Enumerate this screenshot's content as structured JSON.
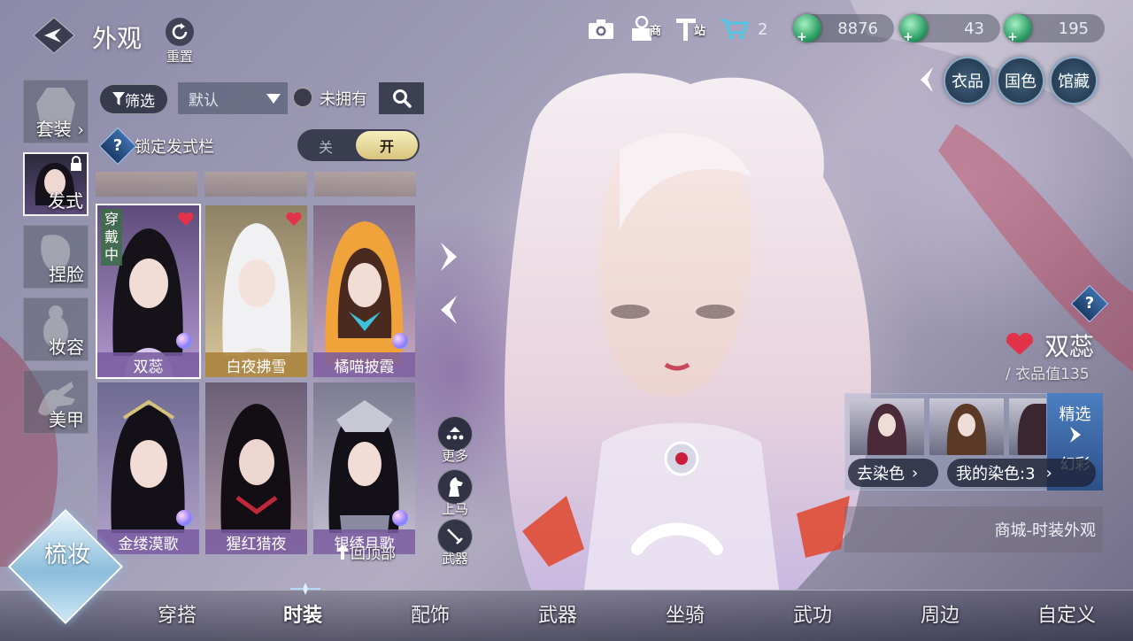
{
  "header": {
    "title": "外观",
    "reset_label": "重置"
  },
  "top_icons": {
    "shop_glyph": "商",
    "station_glyph": "站",
    "cart_count": "2"
  },
  "currencies": [
    "8876",
    "43",
    "195"
  ],
  "right_tabs": [
    "衣品",
    "国色",
    "馆藏"
  ],
  "categories": [
    "套装",
    "发式",
    "捏脸",
    "妆容",
    "美甲"
  ],
  "filter": {
    "filter_label": "筛选",
    "sort_value": "默认",
    "owned_label": "未拥有"
  },
  "lock": {
    "label": "锁定发式栏",
    "off": "关",
    "on": "开"
  },
  "cards": [
    {
      "name": "双蕊",
      "wearing": "穿戴中"
    },
    {
      "name": "白夜拂雪"
    },
    {
      "name": "橘喵披霞"
    },
    {
      "name": "金缕漠歌"
    },
    {
      "name": "猩红猎夜"
    },
    {
      "name": "银绣月歌"
    }
  ],
  "side_buttons": {
    "more": "更多",
    "mount": "上马",
    "weapon": "武器",
    "back_top": "回顶部"
  },
  "character": {
    "name": "双蕊",
    "value_text": "/ 衣品值135"
  },
  "dye": {
    "featured_1": "精选",
    "featured_2": "幻彩",
    "remove_dye": "去染色",
    "my_dye": "我的染色:3",
    "shop_link": "商城-时装外观"
  },
  "comb": "梳妆",
  "bottom_tabs": [
    "穿搭",
    "时装",
    "配饰",
    "武器",
    "坐骑",
    "武功",
    "周边",
    "自定义"
  ],
  "colors": {
    "accent_gold": "#d9c47e",
    "heart_red": "#e2334a",
    "panel_blue": "#2c4f86"
  }
}
